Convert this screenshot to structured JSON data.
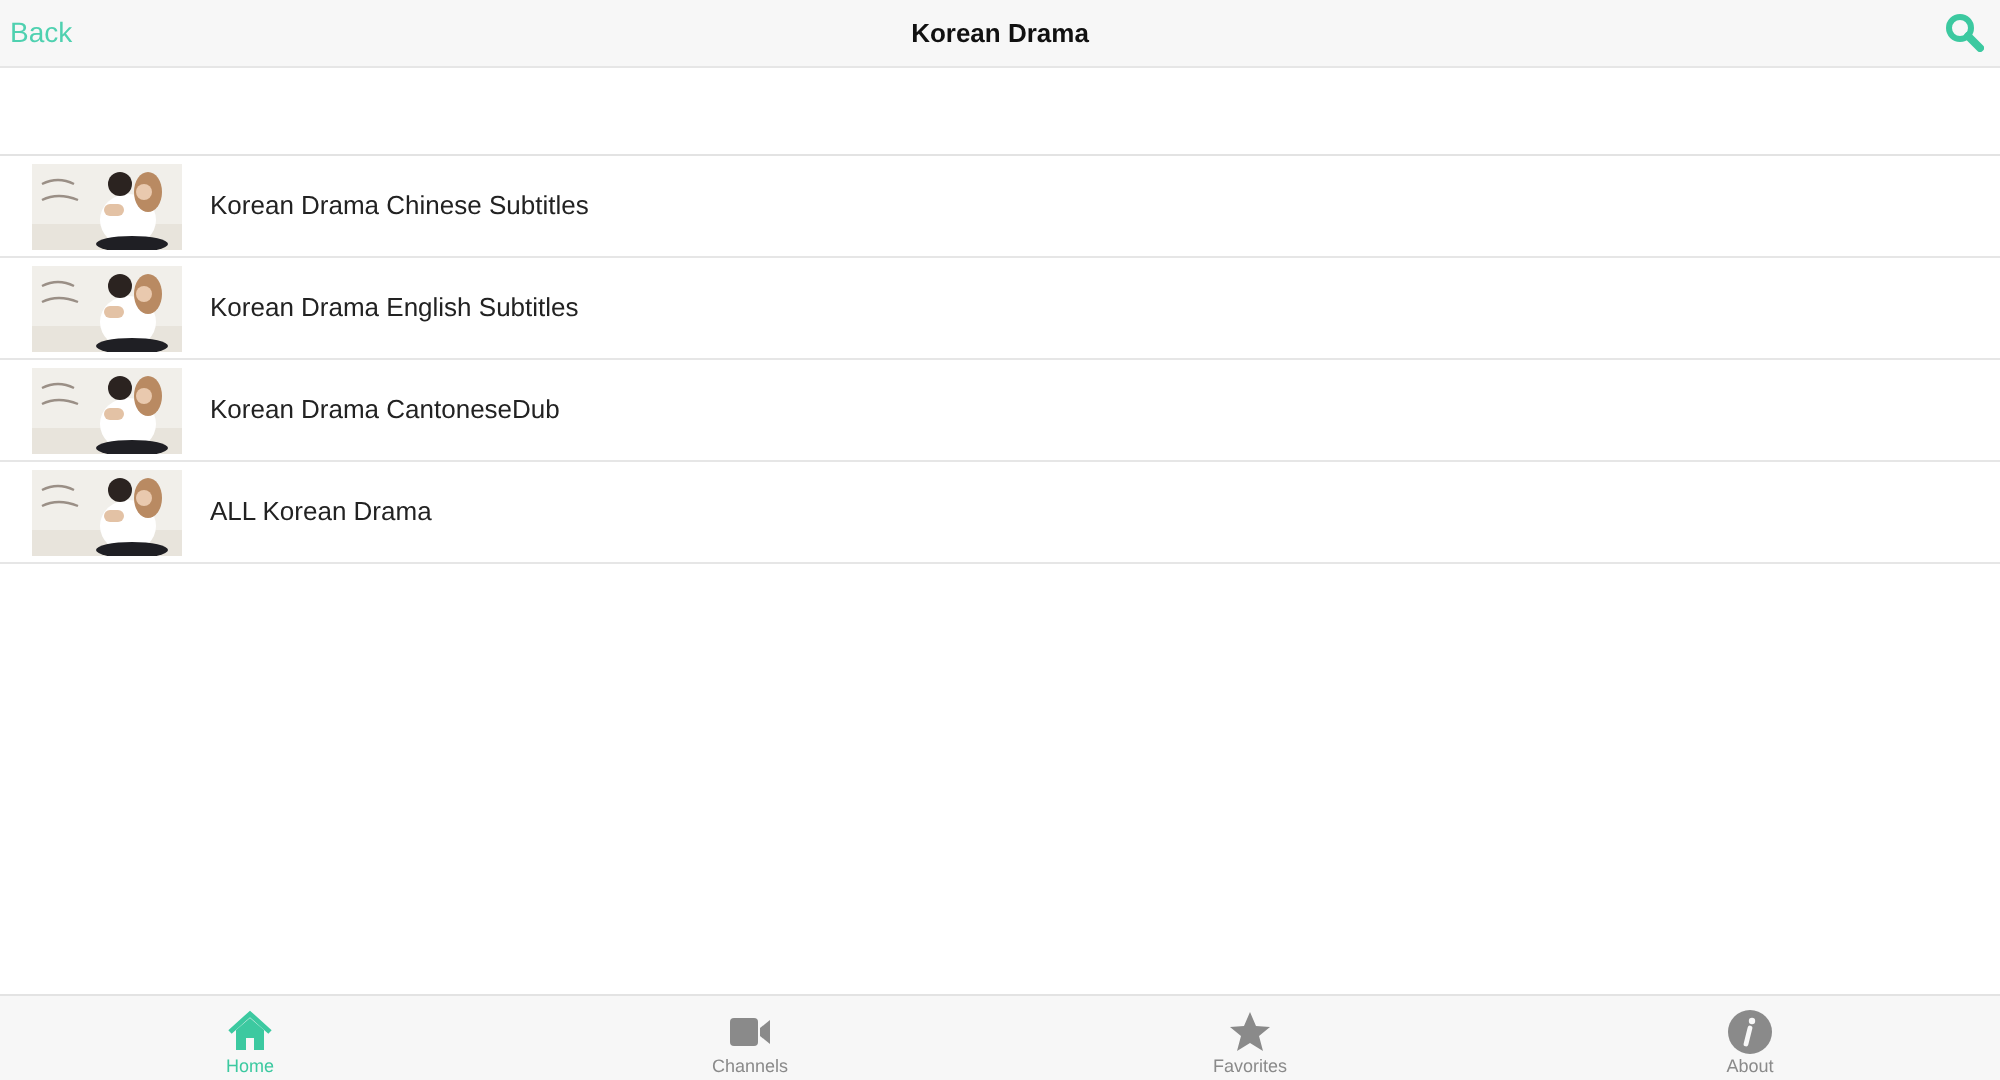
{
  "header": {
    "back": "Back",
    "title": "Korean Drama"
  },
  "items": [
    {
      "label": "Korean Drama Chinese Subtitles"
    },
    {
      "label": "Korean Drama English Subtitles"
    },
    {
      "label": "Korean Drama CantoneseDub"
    },
    {
      "label": "ALL Korean Drama"
    }
  ],
  "tabs": [
    {
      "label": "Home",
      "kind": "home",
      "selected": true
    },
    {
      "label": "Channels",
      "kind": "video",
      "selected": false
    },
    {
      "label": "Favorites",
      "kind": "star",
      "selected": false
    },
    {
      "label": "About",
      "kind": "info",
      "selected": false
    }
  ]
}
